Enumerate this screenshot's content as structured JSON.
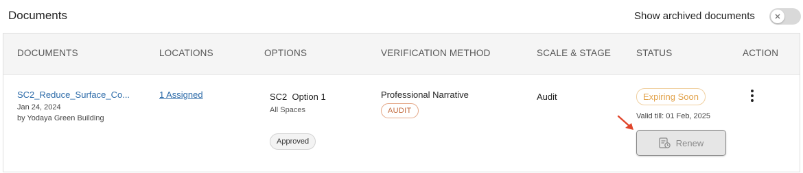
{
  "header": {
    "title": "Documents",
    "toggle_label": "Show archived documents",
    "toggle_on": false
  },
  "table": {
    "columns": [
      "DOCUMENTS",
      "LOCATIONS",
      "OPTIONS",
      "VERIFICATION METHOD",
      "SCALE & STAGE",
      "STATUS",
      "ACTION"
    ],
    "rows": [
      {
        "document_name": "SC2_Reduce_Surface_Co...",
        "document_date": "Jan 24, 2024",
        "document_author": "by Yodaya Green Building",
        "locations": "1 Assigned",
        "option_code": "SC2",
        "option_name": "Option 1",
        "option_scope": "All Spaces",
        "option_status": "Approved",
        "verification_method": "Professional Narrative",
        "verification_badge": "AUDIT",
        "scale_stage": "Audit",
        "status": "Expiring Soon",
        "valid_till": "Valid till: 01 Feb, 2025",
        "renew_label": "Renew"
      }
    ]
  },
  "colors": {
    "link": "#2b6aa8",
    "audit_badge": "#c26a3d",
    "status_expiring": "#e2a24a",
    "arrow": "#e0452b"
  },
  "icons": {
    "renew": "document-refresh-icon",
    "action_menu": "kebab-menu-icon",
    "toggle_knob": "close-icon",
    "pointer": "red-arrow-icon"
  }
}
